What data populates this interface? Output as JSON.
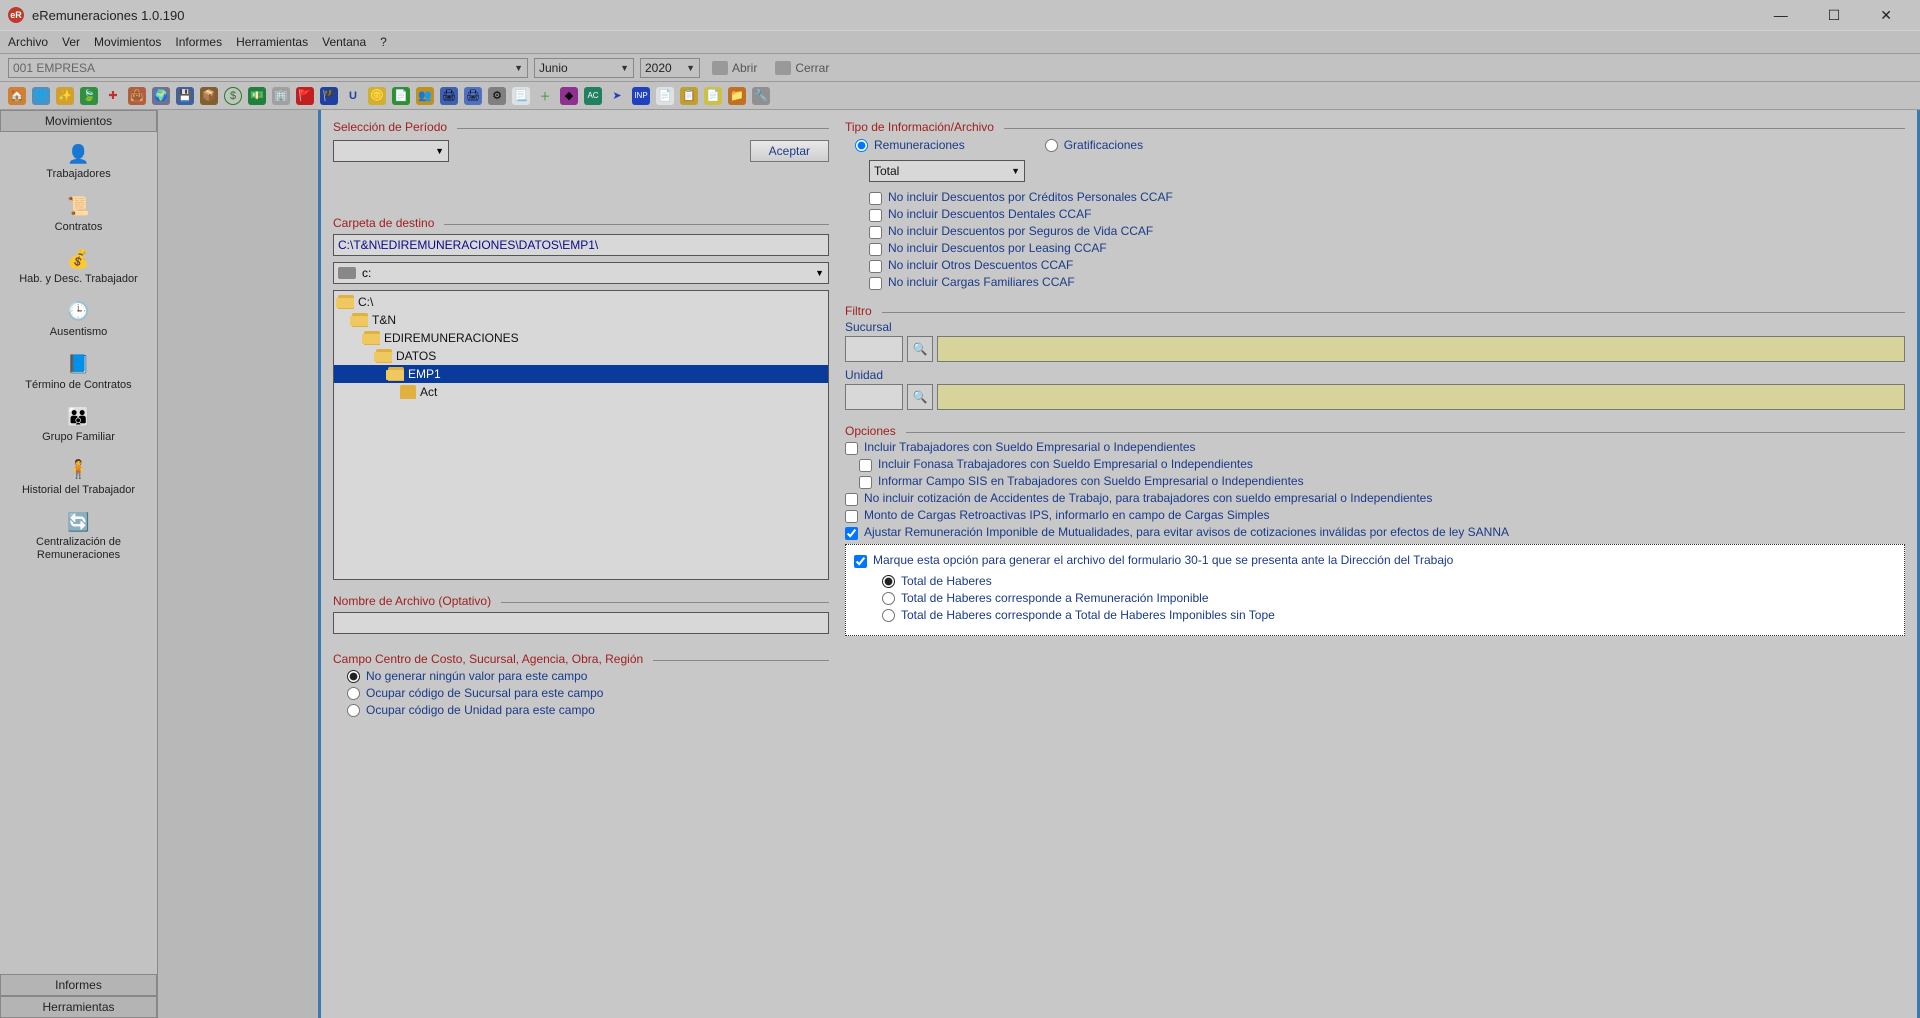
{
  "window": {
    "title": "eRemuneraciones 1.0.190"
  },
  "menu": {
    "archivo": "Archivo",
    "ver": "Ver",
    "movimientos": "Movimientos",
    "informes": "Informes",
    "herramientas": "Herramientas",
    "ventana": "Ventana",
    "ayuda": "?"
  },
  "compbar": {
    "company": "001  EMPRESA",
    "month": "Junio",
    "year": "2020",
    "abrir": "Abrir",
    "cerrar": "Cerrar"
  },
  "sidebar": {
    "section_movimientos": "Movimientos",
    "section_informes": "Informes",
    "section_herramientas": "Herramientas",
    "items": [
      {
        "label": "Trabajadores"
      },
      {
        "label": "Contratos"
      },
      {
        "label": "Hab. y Desc. Trabajador"
      },
      {
        "label": "Ausentismo"
      },
      {
        "label": "Término de Contratos"
      },
      {
        "label": "Grupo Familiar"
      },
      {
        "label": "Historial del Trabajador"
      },
      {
        "label": "Centralización de Remuneraciones"
      }
    ]
  },
  "form": {
    "seleccion_periodo": "Selección de Período",
    "aceptar": "Aceptar",
    "carpeta_destino": "Carpeta de destino",
    "path": "C:\\T&N\\EDIREMUNERACIONES\\DATOS\\EMP1\\",
    "drive": "c:",
    "tree": {
      "c": "C:\\",
      "tn": "T&N",
      "edi": "EDIREMUNERACIONES",
      "datos": "DATOS",
      "emp1": "EMP1",
      "act": "Act"
    },
    "nombre_archivo": "Nombre de Archivo (Optativo)",
    "campo_centro": "Campo Centro de Costo, Sucursal, Agencia, Obra, Región",
    "cc_radio1": "No generar ningún valor para este campo",
    "cc_radio2": "Ocupar código de Sucursal para este campo",
    "cc_radio3": "Ocupar código de Unidad para este campo"
  },
  "right": {
    "tipo_info": "Tipo de Información/Archivo",
    "remuneraciones": "Remuneraciones",
    "gratificaciones": "Gratificaciones",
    "total": "Total",
    "nc1": "No incluir Descuentos por Créditos Personales CCAF",
    "nc2": "No incluir Descuentos Dentales CCAF",
    "nc3": "No incluir Descuentos por Seguros de Vida CCAF",
    "nc4": "No incluir Descuentos por Leasing CCAF",
    "nc5": "No incluir Otros Descuentos CCAF",
    "nc6": "No incluir Cargas Familiares CCAF",
    "filtro": "Filtro",
    "sucursal": "Sucursal",
    "unidad": "Unidad",
    "opciones": "Opciones",
    "op1": "Incluir Trabajadores con Sueldo Empresarial o Independientes",
    "op2": "Incluir Fonasa Trabajadores con Sueldo Empresarial o Independientes",
    "op3": "Informar Campo SIS en Trabajadores con Sueldo Empresarial o Independientes",
    "op4": "No incluir cotización de Accidentes de Trabajo, para trabajadores con sueldo empresarial o Independientes",
    "op5": "Monto de Cargas Retroactivas IPS, informarlo en campo de Cargas Simples",
    "op6": "Ajustar Remuneración Imponible de Mutualidades, para evitar avisos de cotizaciones inválidas por efectos de ley SANNA",
    "op7": "Marque esta opción para generar el archivo del formulario 30-1 que se presenta ante la Dirección del Trabajo",
    "thr1": "Total de Haberes",
    "thr2": "Total de Haberes corresponde a Remuneración Imponible",
    "thr3": "Total de Haberes corresponde a Total de Haberes Imponibles sin Tope"
  }
}
